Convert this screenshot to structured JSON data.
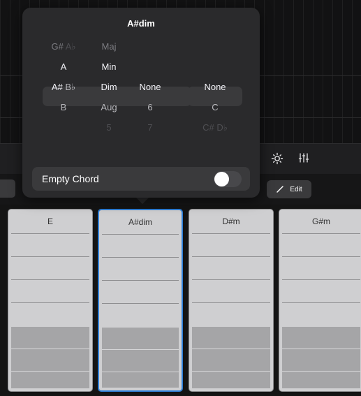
{
  "popover": {
    "title": "A#dim",
    "root_notes": [
      {
        "primary": "G#",
        "alt": "A♭",
        "state": "faded"
      },
      {
        "primary": "A",
        "alt": "",
        "state": "normal"
      },
      {
        "primary": "A#",
        "alt": "B♭",
        "state": "selected"
      },
      {
        "primary": "B",
        "alt": "",
        "state": "normal"
      },
      {
        "primary": "",
        "alt": "",
        "state": "empty"
      }
    ],
    "qualities": [
      "Maj",
      "Min",
      "Dim",
      "Aug",
      "5"
    ],
    "extensions": [
      "",
      "",
      "None",
      "6",
      "7"
    ],
    "bass": [
      "",
      "",
      "None",
      "C",
      "C# D♭"
    ],
    "empty_chord_label": "Empty Chord",
    "empty_chord_on": false
  },
  "toolbar": {
    "metronome_icon": "metronome-icon",
    "mixer_icon": "mixer-sliders-icon",
    "edit_label": "Edit"
  },
  "strips": [
    {
      "name": "E",
      "selected": false
    },
    {
      "name": "A#dim",
      "selected": true
    },
    {
      "name": "D#m",
      "selected": false
    },
    {
      "name": "G#m",
      "selected": false
    }
  ],
  "colors": {
    "accent": "#2f7fd6",
    "popover_bg": "#2a2a2c",
    "strip_bg": "#cfcfd1"
  }
}
